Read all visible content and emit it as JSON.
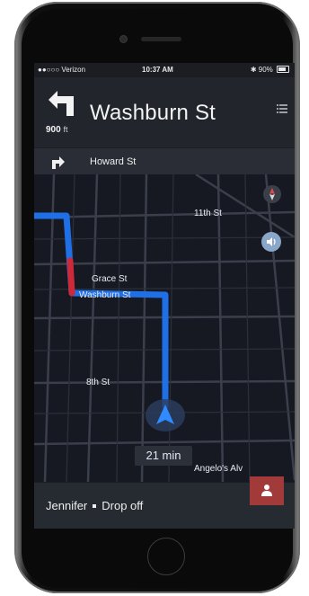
{
  "status_bar": {
    "carrier": "●●○○○ Verizon",
    "time": "10:37 AM",
    "battery": "90%"
  },
  "navigation": {
    "current_street": "Washburn St",
    "distance_value": "900",
    "distance_unit": "ft",
    "next_turn_street": "Howard St"
  },
  "map": {
    "street_labels": {
      "eleventh": "11th St",
      "grace": "Grace St",
      "washburn": "Washburn St",
      "eighth": "8th St",
      "angelos": "Angelo's Alv"
    },
    "eta": "21 min",
    "route_color": "#1f6fe6",
    "traffic_color": "#cc2a3a",
    "sound_button_color": "#8aa6c8"
  },
  "trip": {
    "rider_name": "Jennifer",
    "action": "Drop off",
    "rider_button_color": "#a23a3a"
  }
}
